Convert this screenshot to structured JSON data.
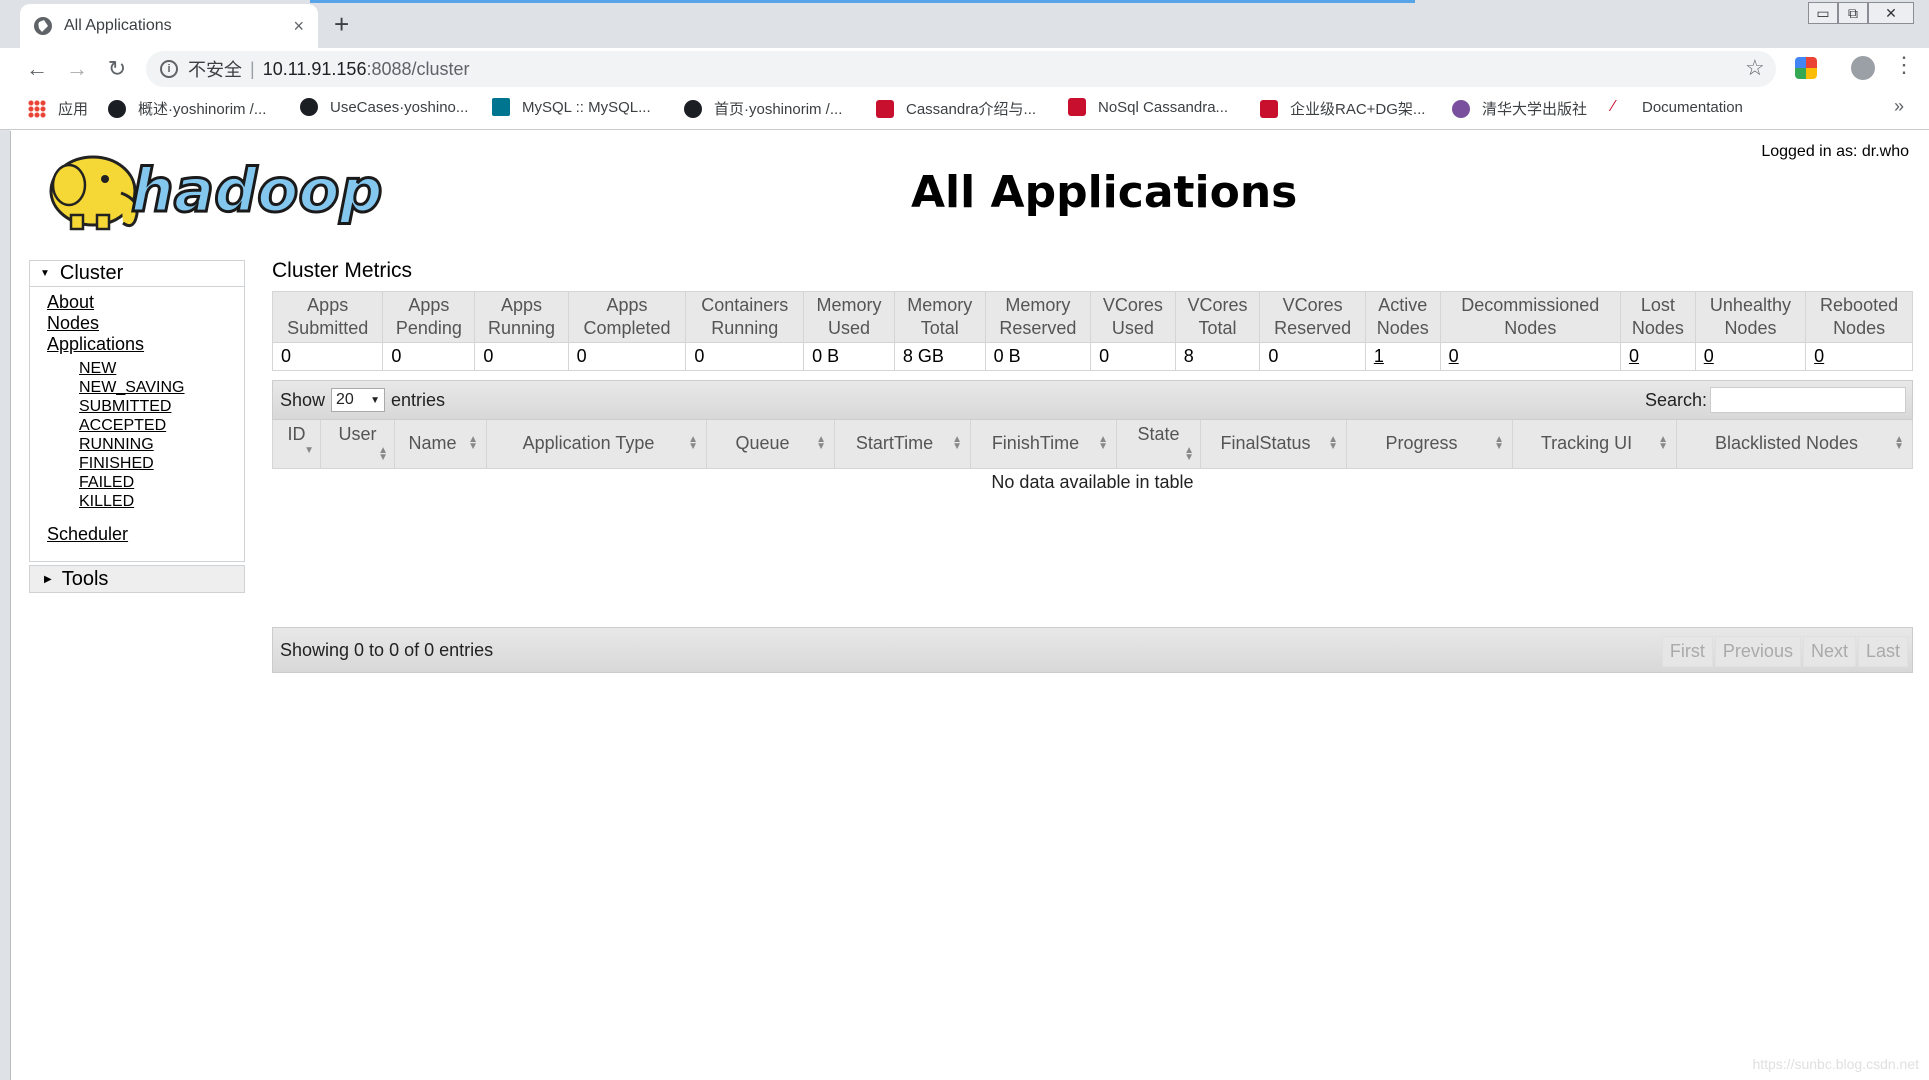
{
  "browser": {
    "tab_title": "All Applications",
    "tab_close": "×",
    "new_tab": "+",
    "insecure_label": "不安全",
    "url_host": "10.11.91.156",
    "url_path": ":8088/cluster",
    "win_minimize": "▭",
    "win_restore": "⧉",
    "win_close": "✕",
    "bookmarks": [
      {
        "label": "应用",
        "icon": "apps-grid-icon"
      },
      {
        "label": "概述·yoshinorim /...",
        "icon": "github-icon"
      },
      {
        "label": "UseCases·yoshino...",
        "icon": "github-icon"
      },
      {
        "label": "MySQL :: MySQL...",
        "icon": "mysql-icon"
      },
      {
        "label": "首页·yoshinorim /...",
        "icon": "github-icon"
      },
      {
        "label": "Cassandra介绍与...",
        "icon": "csdn-icon"
      },
      {
        "label": "NoSql Cassandra...",
        "icon": "csdn-icon"
      },
      {
        "label": "企业级RAC+DG架...",
        "icon": "csdn-icon"
      },
      {
        "label": "清华大学出版社",
        "icon": "tsinghua-icon"
      },
      {
        "label": "Documentation",
        "icon": "pen-icon"
      }
    ],
    "more": "»"
  },
  "page": {
    "title": "All Applications",
    "logged_in": "Logged in as: dr.who",
    "logo_text": "hadoop"
  },
  "sidebar": {
    "cluster_label": "Cluster",
    "cluster_links": [
      "About",
      "Nodes",
      "Applications"
    ],
    "app_states": [
      "NEW",
      "NEW_SAVING",
      "SUBMITTED",
      "ACCEPTED",
      "RUNNING",
      "FINISHED",
      "FAILED",
      "KILLED"
    ],
    "scheduler": "Scheduler",
    "tools_label": "Tools"
  },
  "metrics": {
    "title": "Cluster Metrics",
    "headers": [
      [
        "Apps",
        "Submitted"
      ],
      [
        "Apps",
        "Pending"
      ],
      [
        "Apps",
        "Running"
      ],
      [
        "Apps",
        "Completed"
      ],
      [
        "Containers",
        "Running"
      ],
      [
        "Memory",
        "Used"
      ],
      [
        "Memory",
        "Total"
      ],
      [
        "Memory",
        "Reserved"
      ],
      [
        "VCores",
        "Used"
      ],
      [
        "VCores",
        "Total"
      ],
      [
        "VCores",
        "Reserved"
      ],
      [
        "Active",
        "Nodes"
      ],
      [
        "Decommissioned",
        "Nodes"
      ],
      [
        "Lost",
        "Nodes"
      ],
      [
        "Unhealthy",
        "Nodes"
      ],
      [
        "Rebooted",
        "Nodes"
      ]
    ],
    "values": [
      "0",
      "0",
      "0",
      "0",
      "0",
      "0 B",
      "8 GB",
      "0 B",
      "0",
      "8",
      "0",
      "1",
      "0",
      "0",
      "0",
      "0"
    ],
    "linked": [
      false,
      false,
      false,
      false,
      false,
      false,
      false,
      false,
      false,
      false,
      false,
      true,
      true,
      true,
      true,
      true
    ]
  },
  "apps_table": {
    "show": "Show",
    "page_size": "20",
    "entries": "entries",
    "search_label": "Search:",
    "search_value": "",
    "columns": [
      "ID",
      "User",
      "Name",
      "Application Type",
      "Queue",
      "StartTime",
      "FinishTime",
      "State",
      "FinalStatus",
      "Progress",
      "Tracking UI",
      "Blacklisted Nodes"
    ],
    "empty_message": "No data available in table",
    "info": "Showing 0 to 0 of 0 entries",
    "pager": [
      "First",
      "Previous",
      "Next",
      "Last"
    ]
  },
  "watermark": "https://sunbc.blog.csdn.net"
}
